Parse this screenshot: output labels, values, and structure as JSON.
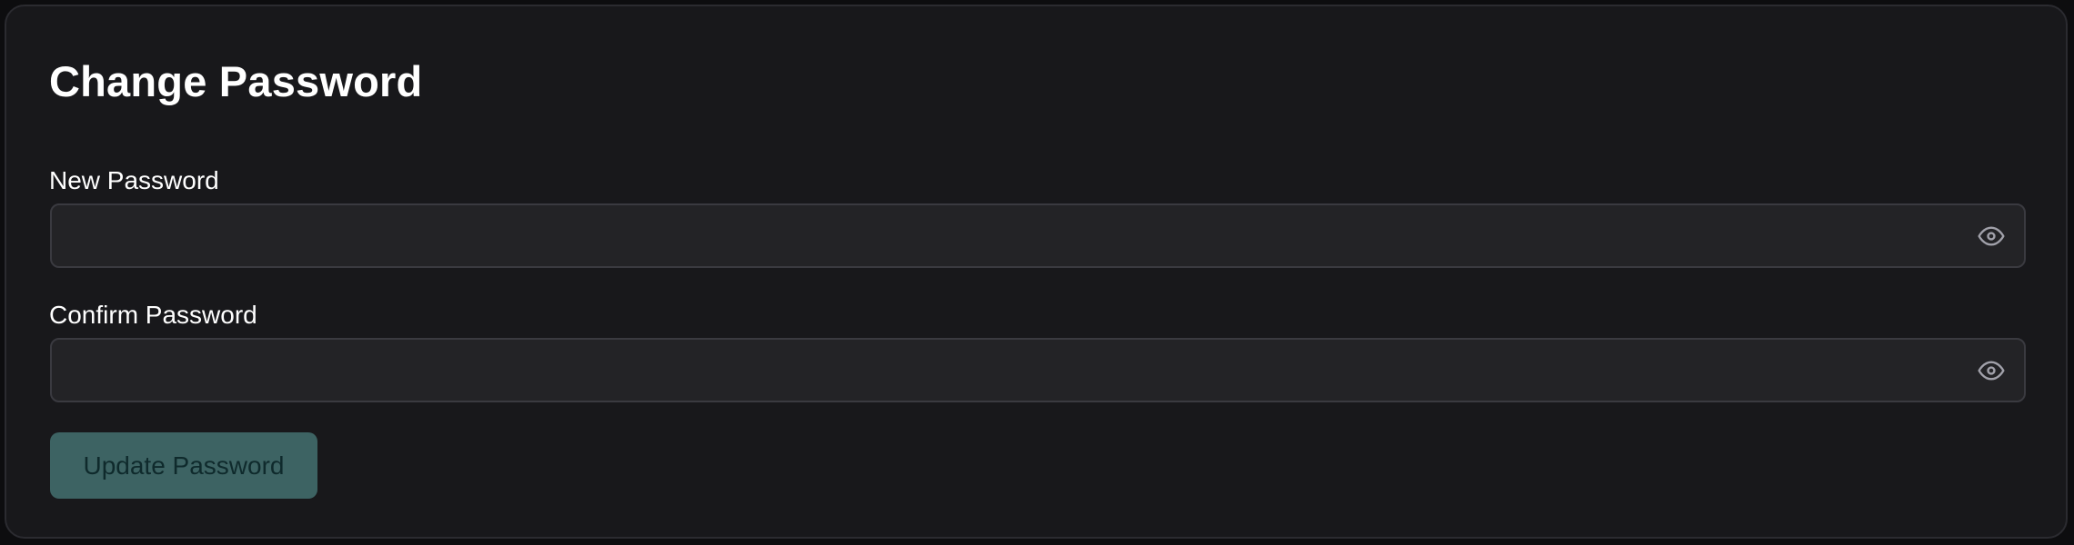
{
  "page": {
    "title": "Change Password"
  },
  "form": {
    "new_password": {
      "label": "New Password",
      "value": "",
      "placeholder": "",
      "toggle_icon": "eye-icon"
    },
    "confirm_password": {
      "label": "Confirm Password",
      "value": "",
      "placeholder": "",
      "toggle_icon": "eye-icon"
    },
    "submit": {
      "label": "Update Password",
      "state": "disabled"
    }
  },
  "colors": {
    "background": "#0d0d0f",
    "card": "#18181b",
    "input": "#232326",
    "border": "#3a3a40",
    "button": "#3d6363",
    "button_text": "#0f2a2c",
    "text": "#ffffff",
    "icon": "#a1a1aa"
  }
}
